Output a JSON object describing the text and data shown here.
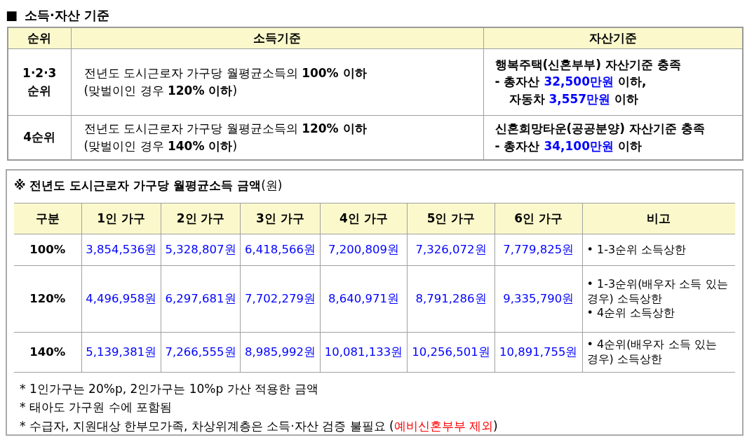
{
  "heading": {
    "marker": "■",
    "text": "소득·자산 기준"
  },
  "criteria_table": {
    "columns": [
      "순위",
      "소득기준",
      "자산기준"
    ],
    "rows": [
      {
        "rank": [
          "1·2·3",
          "순위"
        ],
        "income": [
          "전년도 도시근로자 가구당 월평균소득의 **100% 이하**",
          "(맞벌이인 경우 **120% 이하**)"
        ],
        "asset": [
          {
            "indent": false,
            "segments": [
              {
                "kind": "text",
                "text": "행복주택(신혼부부) 자산기준 충족"
              }
            ]
          },
          {
            "indent": false,
            "segments": [
              {
                "kind": "text",
                "text": "- 총자산 "
              },
              {
                "kind": "amount",
                "text": "32,500만원"
              },
              {
                "kind": "text",
                "text": " 이하,"
              }
            ]
          },
          {
            "indent": true,
            "segments": [
              {
                "kind": "text",
                "text": "자동차 "
              },
              {
                "kind": "amount",
                "text": "3,557만원"
              },
              {
                "kind": "text",
                "text": " 이하"
              }
            ]
          }
        ]
      },
      {
        "rank": [
          "4순위"
        ],
        "income": [
          "전년도 도시근로자 가구당 월평균소득의 **120% 이하**",
          "(맞벌이인 경우 **140% 이하**)"
        ],
        "asset": [
          {
            "indent": false,
            "segments": [
              {
                "kind": "text",
                "text": "신혼희망타운(공공분양) 자산기준 충족"
              }
            ]
          },
          {
            "indent": false,
            "segments": [
              {
                "kind": "text",
                "text": "- 총자산 "
              },
              {
                "kind": "amount",
                "text": "34,100만원"
              },
              {
                "kind": "text",
                "text": " 이하"
              }
            ]
          }
        ]
      }
    ]
  },
  "income_box": {
    "title": "**※ 전년도 도시근로자 가구당 월평균소득 금액**(원)",
    "table": {
      "columns": [
        "구분",
        "1인 가구",
        "2인 가구",
        "3인 가구",
        "4인 가구",
        "5인 가구",
        "6인 가구",
        "비고"
      ],
      "rows": [
        {
          "label": "100%",
          "values": [
            "3,854,536원",
            "5,328,807원",
            "6,418,566원",
            "7,200,809원",
            "7,326,072원",
            "7,779,825원"
          ],
          "remarks": [
            "• 1-3순위  소득상한"
          ]
        },
        {
          "label": "120%",
          "values": [
            "4,496,958원",
            "6,297,681원",
            "7,702,279원",
            "8,640,971원",
            "8,791,286원",
            "9,335,790원"
          ],
          "remarks": [
            "• 1-3순위(배우자 소득 있는 경우) 소득상한",
            "• 4순위  소득상한"
          ]
        },
        {
          "label": "140%",
          "values": [
            "5,139,381원",
            "7,266,555원",
            "8,985,992원",
            "10,081,133원",
            "10,256,501원",
            "10,891,755원"
          ],
          "remarks": [
            "• 4순위(배우자 소득 있는 경우) 소득상한"
          ]
        }
      ]
    },
    "notes": [
      [
        {
          "kind": "text",
          "text": "* 1인가구는 20%p, 2인가구는 10%p 가산 적용한 금액"
        }
      ],
      [
        {
          "kind": "text",
          "text": "* 태아도 가구원 수에 포함됨"
        }
      ],
      [
        {
          "kind": "text",
          "text": "* 수급자, 지원대상 한부모가족, 차상위계층은 소득·자산 검증 불필요 ("
        },
        {
          "kind": "highlight",
          "text": "예비신혼부부 제외"
        },
        {
          "kind": "text",
          "text": ")"
        }
      ]
    ]
  }
}
